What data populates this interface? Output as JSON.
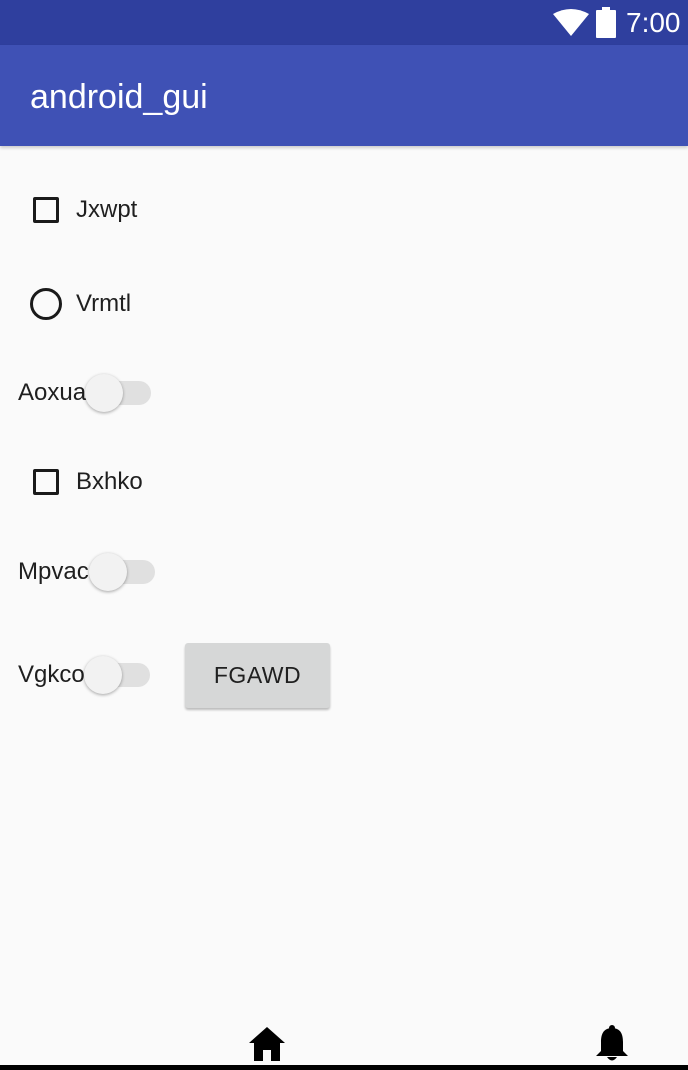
{
  "status_bar": {
    "time": "7:00",
    "icons": [
      "wifi-icon",
      "battery-icon"
    ],
    "background": "#2f3f9e"
  },
  "app_bar": {
    "title": "android_gui",
    "background": "#3f51b5"
  },
  "controls": {
    "checkbox_1": {
      "label": "Jxwpt",
      "checked": false
    },
    "radio_1": {
      "label": "Vrmtl",
      "selected": false
    },
    "switch_1": {
      "label": "Aoxua",
      "on": false
    },
    "checkbox_2": {
      "label": "Bxhko",
      "checked": false
    },
    "switch_2": {
      "label": "Mpvac",
      "on": false
    },
    "switch_3": {
      "label": "Vgkco",
      "on": false
    },
    "button_1": {
      "label": "FGAWD"
    }
  },
  "nav_bar": {
    "icons": [
      "home-icon",
      "notification-bell-icon"
    ]
  }
}
